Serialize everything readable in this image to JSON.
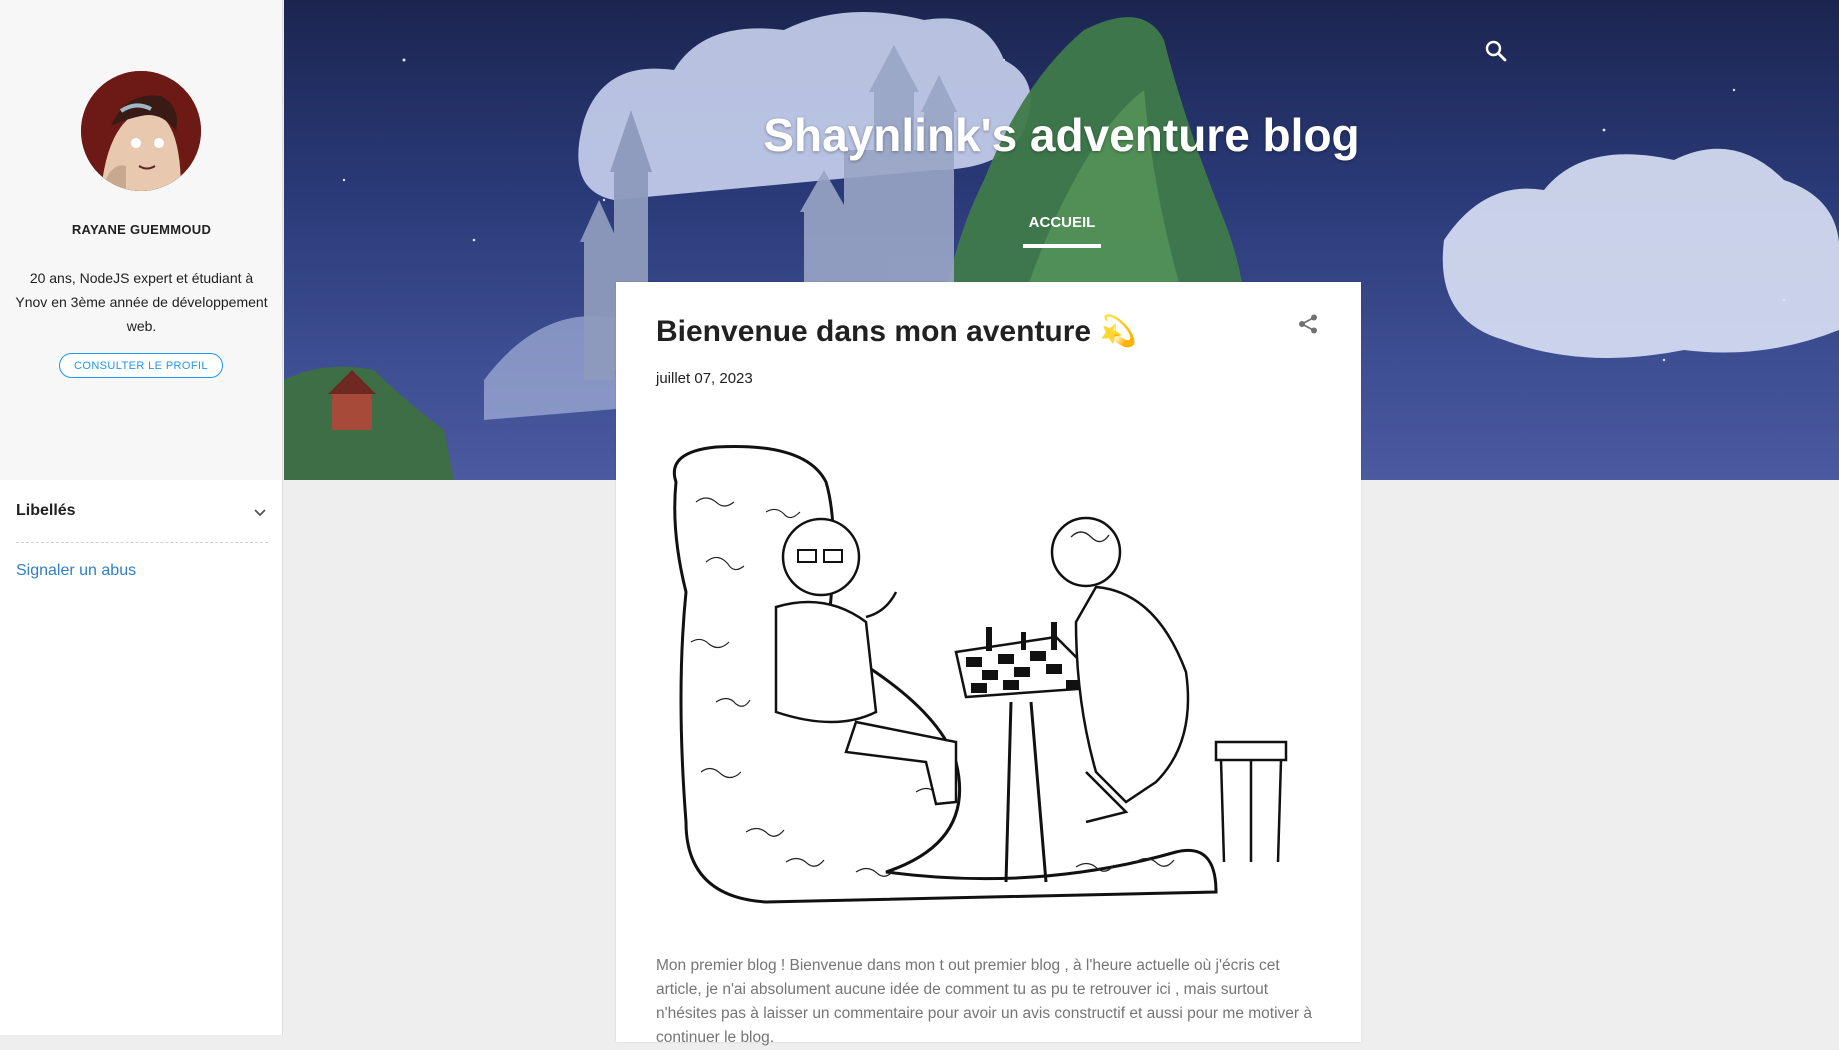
{
  "colors": {
    "accent": "#2196f3",
    "link": "#2f7fc5",
    "header_overlay": "#2a3a78",
    "page_bg": "#eeeeee"
  },
  "sidebar": {
    "author_name": "RAYANE GUEMMOUD",
    "bio": "20 ans, NodeJS expert et étudiant à Ynov en 3ème année de développement web.",
    "profile_button": "CONSULTER LE PROFIL",
    "labels_title": "Libellés",
    "labels_icon": "chevron-down-icon",
    "report_link": "Signaler un abus"
  },
  "header": {
    "blog_title": "Shaynlink's adventure blog",
    "nav": [
      {
        "label": "ACCUEIL",
        "active": true
      }
    ],
    "search_icon": "search-icon"
  },
  "post": {
    "title": "Bienvenue dans mon aventure 💫",
    "date": "juillet 07, 2023",
    "share_icon": "share-icon",
    "body": "Mon premier blog ! Bienvenue dans mon t out premier blog , à l'heure actuelle où j'écris cet article, je n'ai absolument aucune idée de comment tu as pu te retrouver ici , mais surtout n'hésites pas à laisser un commentaire pour avoir un avis constructif et aussi pour me motiver à continuer le blog."
  }
}
